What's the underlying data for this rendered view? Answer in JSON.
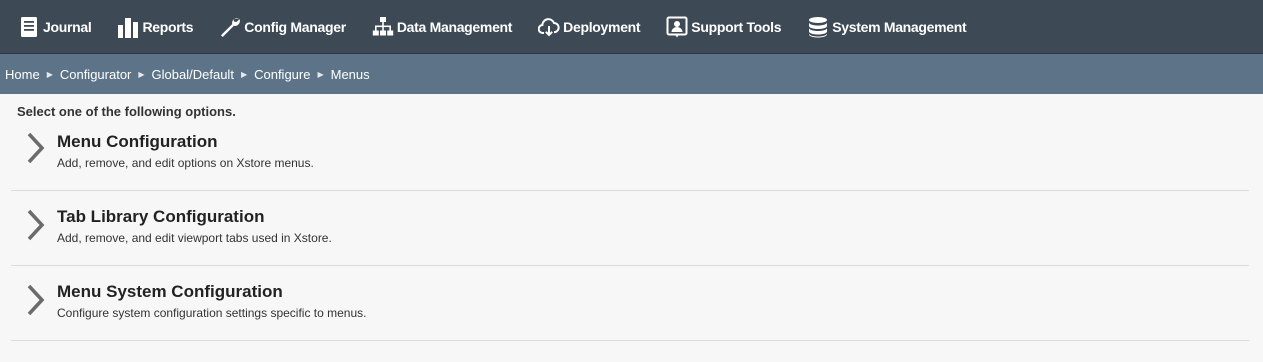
{
  "topnav": {
    "items": [
      {
        "label": "Journal",
        "icon": "journal-icon"
      },
      {
        "label": "Reports",
        "icon": "bar-chart-icon"
      },
      {
        "label": "Config Manager",
        "icon": "wrench-icon"
      },
      {
        "label": "Data Management",
        "icon": "org-chart-icon"
      },
      {
        "label": "Deployment",
        "icon": "cloud-download-icon"
      },
      {
        "label": "Support Tools",
        "icon": "support-person-icon"
      },
      {
        "label": "System Management",
        "icon": "database-icon"
      }
    ]
  },
  "breadcrumb": {
    "items": [
      "Home",
      "Configurator",
      "Global/Default",
      "Configure",
      "Menus"
    ],
    "separator": "▶"
  },
  "main": {
    "instruction": "Select one of the following options.",
    "options": [
      {
        "title": "Menu Configuration",
        "description": "Add, remove, and edit options on Xstore menus."
      },
      {
        "title": "Tab Library Configuration",
        "description": "Add, remove, and edit viewport tabs used in Xstore."
      },
      {
        "title": "Menu System Configuration",
        "description": "Configure system configuration settings specific to menus."
      }
    ]
  },
  "colors": {
    "topnav_bg": "#3d4a55",
    "breadcrumb_bg": "#5d7488",
    "page_bg": "#f7f7f7",
    "chevron": "#6b6b6b"
  }
}
